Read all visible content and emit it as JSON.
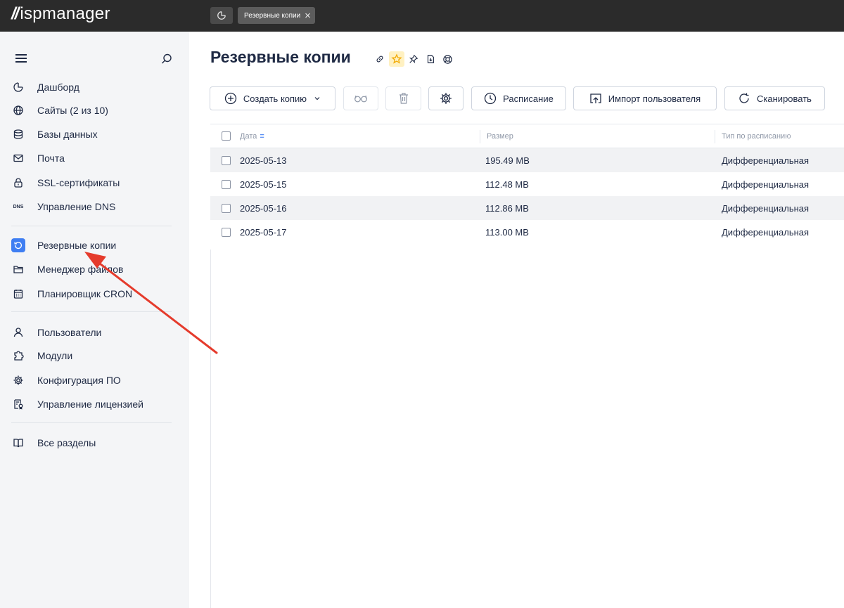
{
  "app": {
    "logo_mark": "//",
    "logo_text": "ispmanager"
  },
  "tabs": {
    "open_tab_label": "Резервные копии"
  },
  "sidebar": {
    "items": [
      {
        "label": "Дашборд",
        "icon": "dashboard-icon"
      },
      {
        "label": "Сайты (2 из 10)",
        "icon": "globe-icon"
      },
      {
        "label": "Базы данных",
        "icon": "database-icon"
      },
      {
        "label": "Почта",
        "icon": "mail-icon"
      },
      {
        "label": "SSL-сертификаты",
        "icon": "lock-icon"
      },
      {
        "label": "Управление DNS",
        "icon": "dns-icon",
        "icon_text": "DNS"
      },
      {
        "label": "Резервные копии",
        "icon": "backup-icon",
        "active": true
      },
      {
        "label": "Менеджер файлов",
        "icon": "folder-icon"
      },
      {
        "label": "Планировщик CRON",
        "icon": "calendar-icon"
      },
      {
        "label": "Пользователи",
        "icon": "user-icon"
      },
      {
        "label": "Модули",
        "icon": "puzzle-icon"
      },
      {
        "label": "Конфигурация ПО",
        "icon": "gear-icon"
      },
      {
        "label": "Управление лицензией",
        "icon": "license-icon"
      },
      {
        "label": "Все разделы",
        "icon": "book-icon"
      }
    ]
  },
  "page": {
    "title": "Резервные копии"
  },
  "toolbar": {
    "create_label": "Создать копию",
    "schedule_label": "Расписание",
    "import_label": "Импорт пользователя",
    "scan_label": "Сканировать"
  },
  "table": {
    "columns": [
      "Дата",
      "Размер",
      "Тип по расписанию"
    ],
    "rows": [
      {
        "date": "2025-05-13",
        "size": "195.49 MB",
        "type": "Дифференциальная"
      },
      {
        "date": "2025-05-15",
        "size": "112.48 MB",
        "type": "Дифференциальная"
      },
      {
        "date": "2025-05-16",
        "size": "112.86 MB",
        "type": "Дифференциальная"
      },
      {
        "date": "2025-05-17",
        "size": "113.00 MB",
        "type": "Дифференциальная"
      }
    ]
  },
  "colors": {
    "accent": "#3f7ef2",
    "annotation_arrow": "#e53b2c",
    "topbar": "#2b2b2b",
    "sidebar_bg": "#f4f5f7"
  }
}
